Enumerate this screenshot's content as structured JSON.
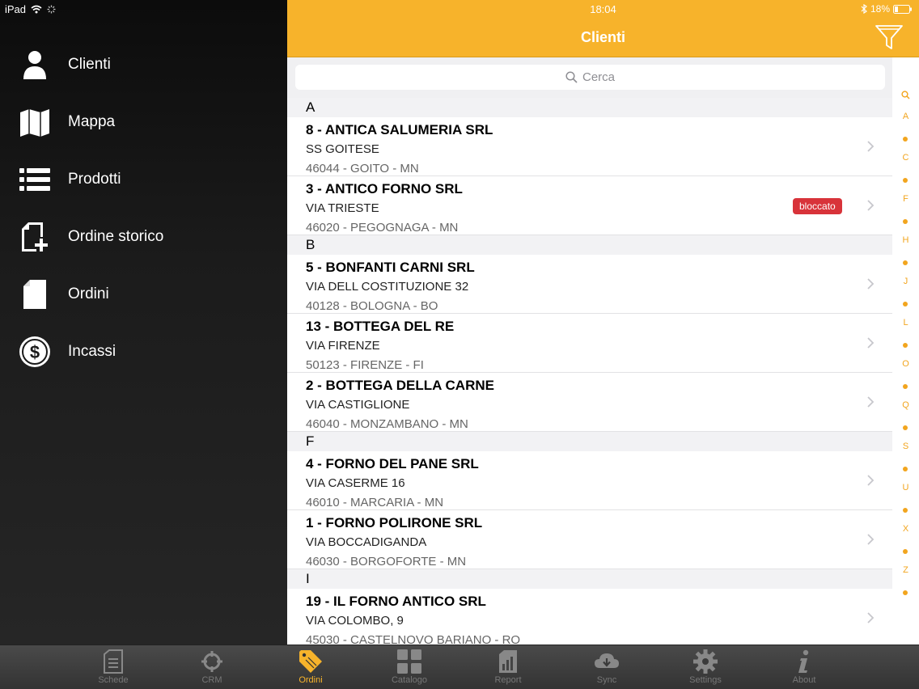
{
  "status": {
    "device": "iPad",
    "time": "18:04",
    "battery": "18%"
  },
  "sidebar": {
    "items": [
      {
        "label": "Clienti",
        "icon": "person-icon"
      },
      {
        "label": "Mappa",
        "icon": "map-icon"
      },
      {
        "label": "Prodotti",
        "icon": "list-icon"
      },
      {
        "label": "Ordine storico",
        "icon": "add-document-icon"
      },
      {
        "label": "Ordini",
        "icon": "document-icon"
      },
      {
        "label": "Incassi",
        "icon": "dollar-coin-icon"
      }
    ]
  },
  "navbar": {
    "title": "Clienti",
    "filter_icon": "funnel-icon"
  },
  "search": {
    "placeholder": "Cerca"
  },
  "list": {
    "sections": [
      {
        "letter": "A",
        "rows": [
          {
            "title": "8 - ANTICA SALUMERIA SRL",
            "street": "SS GOITESE",
            "city": "46044 - GOITO - MN",
            "badge": ""
          },
          {
            "title": "3 - ANTICO FORNO SRL",
            "street": "VIA TRIESTE",
            "city": "46020 - PEGOGNAGA - MN",
            "badge": "bloccato"
          }
        ]
      },
      {
        "letter": "B",
        "rows": [
          {
            "title": "5 - BONFANTI CARNI SRL",
            "street": "VIA DELL COSTITUZIONE 32",
            "city": "40128 - BOLOGNA - BO",
            "badge": ""
          },
          {
            "title": "13 - BOTTEGA DEL RE",
            "street": "VIA FIRENZE",
            "city": "50123 - FIRENZE - FI",
            "badge": ""
          },
          {
            "title": "2 - BOTTEGA DELLA CARNE",
            "street": "VIA CASTIGLIONE",
            "city": "46040 - MONZAMBANO - MN",
            "badge": ""
          }
        ]
      },
      {
        "letter": "F",
        "rows": [
          {
            "title": "4 - FORNO DEL PANE SRL",
            "street": "VIA CASERME 16",
            "city": "46010 - MARCARIA - MN",
            "badge": ""
          },
          {
            "title": "1 - FORNO POLIRONE SRL",
            "street": "VIA BOCCADIGANDA",
            "city": "46030 - BORGOFORTE - MN",
            "badge": ""
          }
        ]
      },
      {
        "letter": "I",
        "rows": [
          {
            "title": "19 - IL FORNO ANTICO SRL",
            "street": "VIA COLOMBO, 9",
            "city": "45030 - CASTELNOVO BARIANO - RO",
            "badge": ""
          }
        ]
      }
    ]
  },
  "index": [
    "A",
    "C",
    "F",
    "H",
    "J",
    "L",
    "O",
    "Q",
    "S",
    "U",
    "X",
    "Z"
  ],
  "tabbar": {
    "tabs": [
      {
        "label": "Schede",
        "icon": "clipboard-icon"
      },
      {
        "label": "CRM",
        "icon": "crosshair-icon"
      },
      {
        "label": "Ordini",
        "icon": "tag-icon",
        "active": true
      },
      {
        "label": "Catalogo",
        "icon": "grid-icon"
      },
      {
        "label": "Report",
        "icon": "report-icon"
      },
      {
        "label": "Sync",
        "icon": "cloud-download-icon"
      },
      {
        "label": "Settings",
        "icon": "gear-icon"
      },
      {
        "label": "About",
        "icon": "info-icon"
      }
    ]
  },
  "colors": {
    "accent": "#f7b32b",
    "badge": "#d8333a"
  }
}
